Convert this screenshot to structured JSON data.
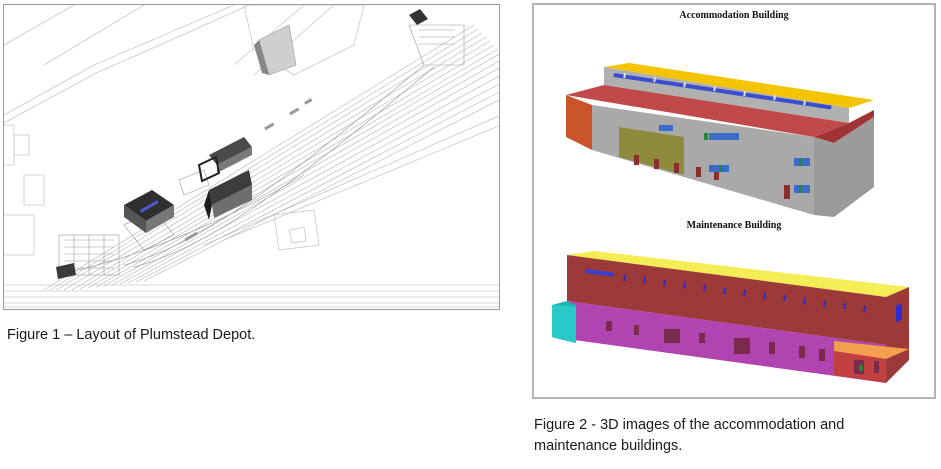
{
  "figure1": {
    "caption": "Figure 1 – Layout of Plumstead Depot."
  },
  "figure2": {
    "label_top": "Accommodation Building",
    "label_bottom": "Maintenance Building",
    "caption": "Figure 2 - 3D images of the accommodation and maintenance buildings."
  },
  "colors": {
    "roof_yellow": "#f5c400",
    "roof_red": "#c04a4a",
    "wall_grey": "#a9a9a9",
    "wall_purple": "#b044b0",
    "wall_brown": "#9c3a3a",
    "accent_cyan": "#1fb5b5"
  }
}
